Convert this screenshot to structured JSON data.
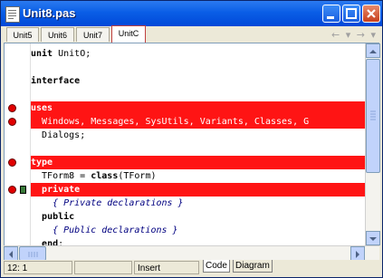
{
  "window": {
    "title": "Unit8.pas",
    "icons": {
      "app": "document-icon",
      "minimize": "minimize-icon",
      "maximize": "maximize-icon",
      "close": "close-icon"
    }
  },
  "tabs": [
    {
      "label": "Unit5",
      "active": false
    },
    {
      "label": "Unit6",
      "active": false
    },
    {
      "label": "Unit7",
      "active": false
    },
    {
      "label": "UnitC",
      "active": true
    }
  ],
  "nav": {
    "back": "←",
    "forward": "→",
    "dropdown": "▾"
  },
  "code_lines": [
    {
      "text": "unit UnitO;",
      "highlight": false,
      "breakpoint": false
    },
    {
      "text": "",
      "highlight": false,
      "breakpoint": false
    },
    {
      "text": "interface",
      "highlight": false,
      "breakpoint": false
    },
    {
      "text": "",
      "highlight": false,
      "breakpoint": false
    },
    {
      "text": "uses",
      "highlight": true,
      "breakpoint": true
    },
    {
      "text": "  Windows, Messages, SysUtils, Variants, Classes, G",
      "highlight": true,
      "breakpoint": true
    },
    {
      "text": "  Dialogs;",
      "highlight": false,
      "breakpoint": false
    },
    {
      "text": "",
      "highlight": false,
      "breakpoint": false
    },
    {
      "text": "type",
      "highlight": true,
      "breakpoint": true
    },
    {
      "text": "  TForm8 = class(TForm)",
      "highlight": false,
      "breakpoint": false
    },
    {
      "text": "  private",
      "highlight": true,
      "breakpoint": true,
      "exec": true
    },
    {
      "text": "    { Private declarations }",
      "highlight": false,
      "breakpoint": false
    },
    {
      "text": "  public",
      "highlight": false,
      "breakpoint": false
    },
    {
      "text": "    { Public declarations }",
      "highlight": false,
      "breakpoint": false
    },
    {
      "text": "  end;",
      "highlight": false,
      "breakpoint": false
    }
  ],
  "status": {
    "position": "12:  1",
    "mode": "",
    "insert": "Insert",
    "views": [
      {
        "label": "Code",
        "active": true
      },
      {
        "label": "Diagram",
        "active": false
      }
    ]
  },
  "colors": {
    "highlight": "#ff1414",
    "breakpoint": "#e00000",
    "titlebar": "#0a5ee6"
  }
}
